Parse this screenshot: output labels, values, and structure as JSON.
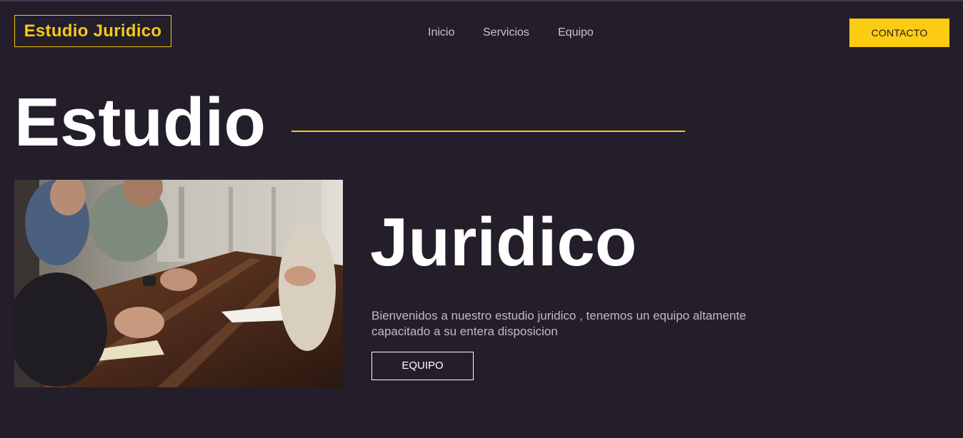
{
  "header": {
    "logo_text": "Estudio Juridico",
    "nav": [
      {
        "label": "Inicio"
      },
      {
        "label": "Servicios"
      },
      {
        "label": "Equipo"
      }
    ],
    "cta_label": "CONTACTO"
  },
  "hero": {
    "title_line1": "Estudio",
    "title_line2": "Juridico",
    "description": "Bienvenidos a nuestro estudio juridico , tenemos un equipo altamente capacitado a su entera disposicion",
    "button_label": "EQUIPO",
    "image_subject": "meeting-at-wooden-table-photo"
  },
  "colors": {
    "background": "#231e2a",
    "accent": "#fccc12",
    "text": "#ffffff",
    "muted_text": "#c0bac7"
  }
}
